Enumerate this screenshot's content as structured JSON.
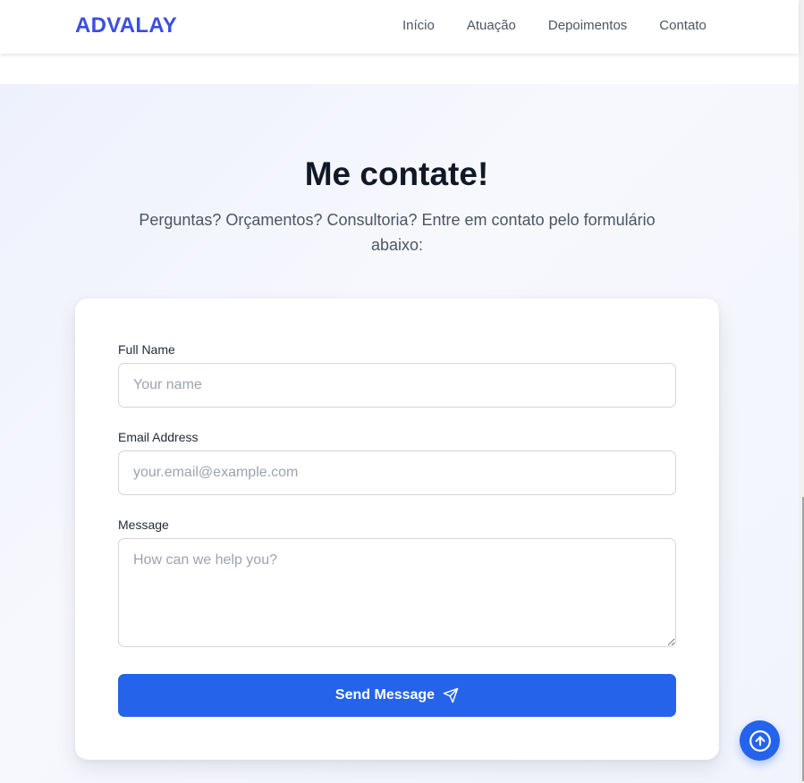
{
  "brand": {
    "name": "ADVALAY",
    "color": "#3b4fe0"
  },
  "nav": {
    "items": [
      {
        "label": "Início"
      },
      {
        "label": "Atuação"
      },
      {
        "label": "Depoimentos"
      },
      {
        "label": "Contato"
      }
    ]
  },
  "contact": {
    "title": "Me contate!",
    "subtitle": "Perguntas? Orçamentos? Consultoria? Entre em contato pelo formulário abaixo:",
    "form": {
      "name": {
        "label": "Full Name",
        "placeholder": "Your name",
        "value": ""
      },
      "email": {
        "label": "Email Address",
        "placeholder": "your.email@example.com",
        "value": ""
      },
      "message": {
        "label": "Message",
        "placeholder": "How can we help you?",
        "value": ""
      },
      "submit_label": "Send Message",
      "submit_icon": "send-icon"
    }
  },
  "scroll_top": {
    "icon": "arrow-up-circle-icon"
  },
  "colors": {
    "accent": "#2563eb",
    "heading": "#111827",
    "body_text": "#4b5563",
    "section_background": "#eef1fd"
  }
}
